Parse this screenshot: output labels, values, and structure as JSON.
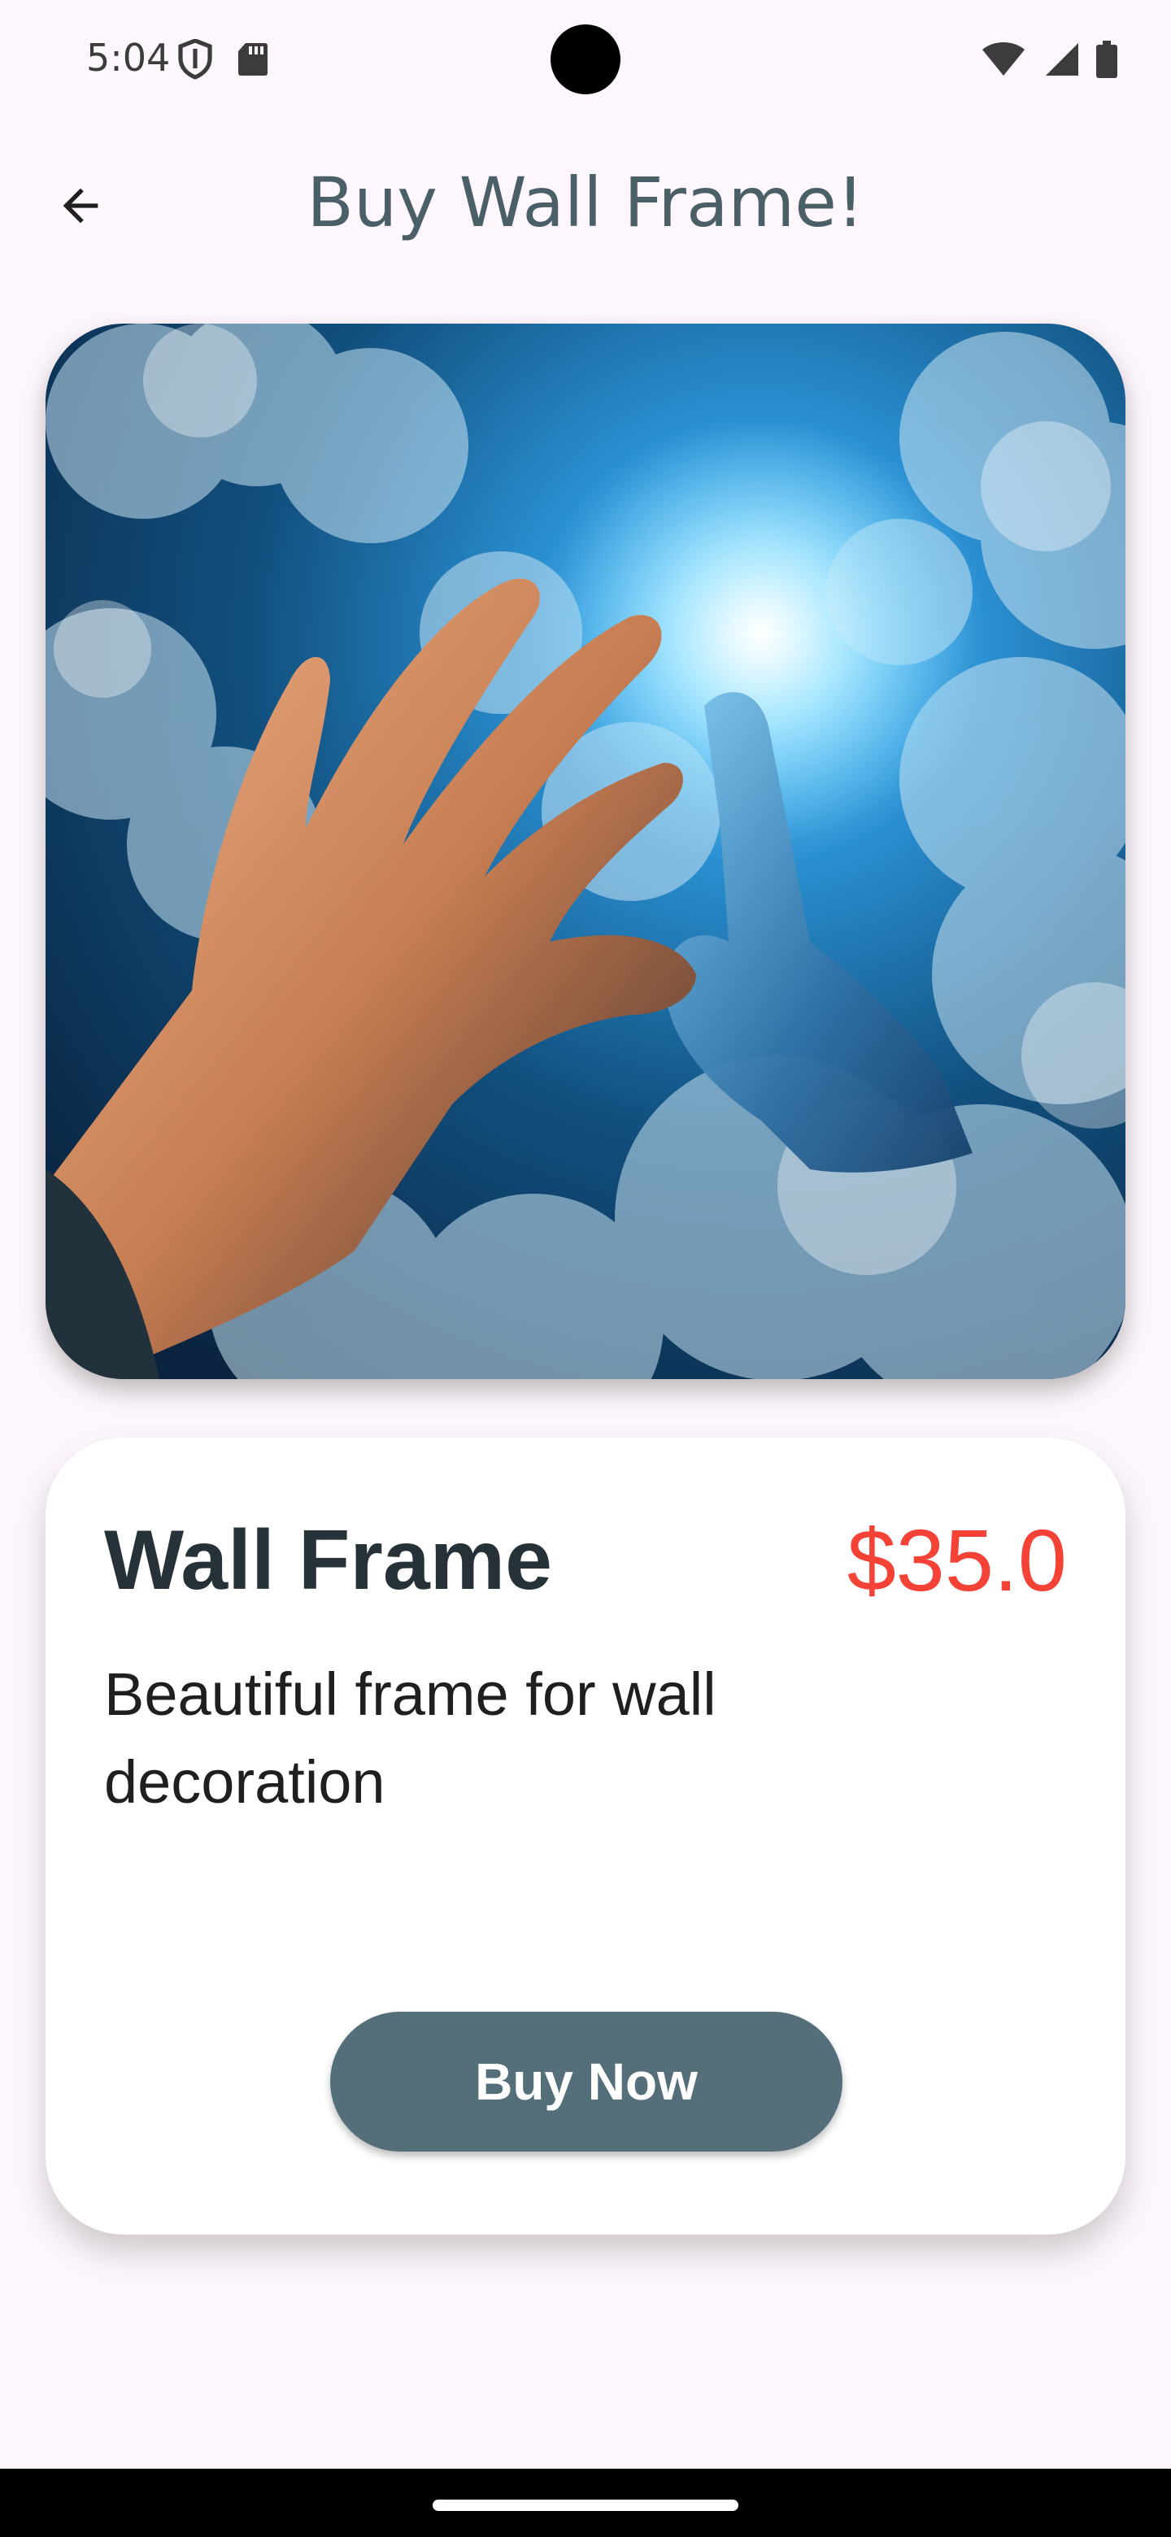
{
  "status_bar": {
    "time": "5:04",
    "icons_left": [
      "shield-icon",
      "sd-card-icon"
    ],
    "icons_right": [
      "wifi-icon",
      "cellular-signal-icon",
      "battery-icon"
    ]
  },
  "app_bar": {
    "title": "Buy Wall Frame!",
    "back_icon": "arrow-back-icon"
  },
  "product": {
    "image_alt": "",
    "name": "Wall Frame",
    "price": "$35.0",
    "description": "Beautiful frame for wall decoration",
    "buy_label": "Buy Now"
  },
  "colors": {
    "background": "#fdf6fc",
    "title": "#4b5f66",
    "price": "#f44336",
    "button": "#546e7a",
    "name": "#263238"
  }
}
